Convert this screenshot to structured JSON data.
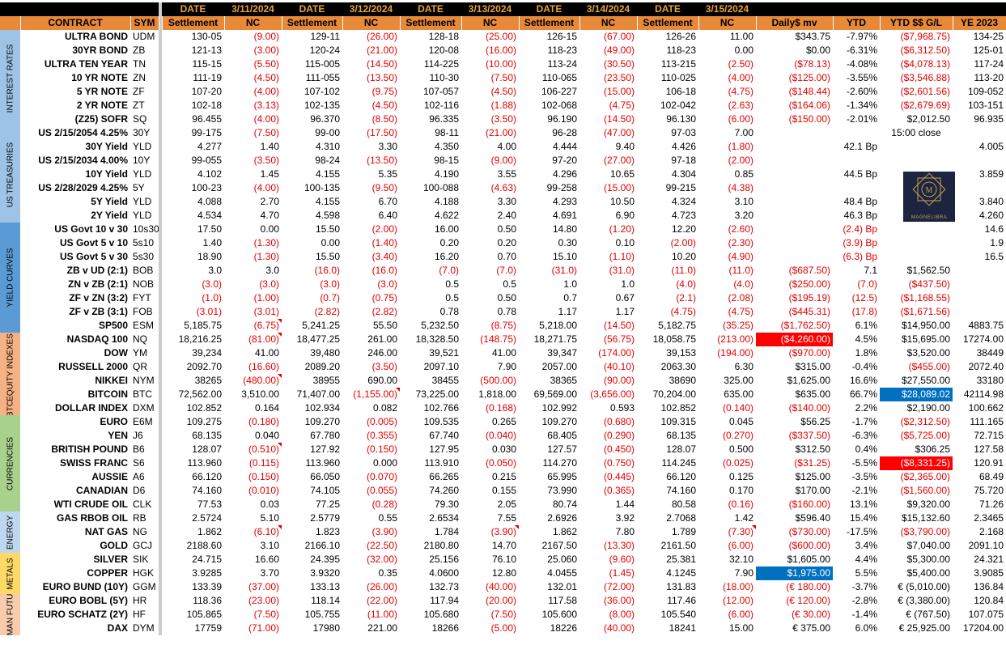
{
  "header_row1": [
    "",
    "",
    "",
    "DATE",
    "3/11/2024",
    "DATE",
    "3/12/2024",
    "DATE",
    "3/13/2024",
    "DATE",
    "3/14/2024",
    "DATE",
    "3/15/2024",
    "",
    "",
    "",
    ""
  ],
  "header_row2": [
    "",
    "CONTRACT",
    "SYM",
    "Settlement",
    "NC",
    "Settlement",
    "NC",
    "Settlement",
    "NC",
    "Settlement",
    "NC",
    "Settlement",
    "NC",
    "Daily$ mv",
    "YTD",
    "YTD $$ G/L",
    "YE 2023"
  ],
  "sections": [
    {
      "label": "INTEREST RATES",
      "color": "#9dc3e6",
      "rows": 7
    },
    {
      "label": "US TREASURIES",
      "color": "#9dc3e6",
      "rows": 7
    },
    {
      "label": "YIELD CURVES",
      "color": "#5b9bd5",
      "rows": 8
    },
    {
      "label": "EQUITY INDEXES",
      "color": "#f4b183",
      "rows": 5
    },
    {
      "label": "BTC",
      "color": "#f4b183",
      "rows": 1
    },
    {
      "label": "CURRENCIES",
      "color": "#a9d18e",
      "rows": 7
    },
    {
      "label": "ENERGY",
      "color": "#bdd7ee",
      "rows": 3
    },
    {
      "label": "METALS",
      "color": "#ffd966",
      "rows": 3
    },
    {
      "label": "GERMAN FUTURES",
      "color": "#f8cbad",
      "rows": 4
    }
  ],
  "rows": [
    [
      "ULTRA BOND",
      "UDM",
      "130-05",
      "(9.00)",
      "129-11",
      "(26.00)",
      "128-18",
      "(25.00)",
      "126-15",
      "(67.00)",
      "126-26",
      "11.00",
      "$343.75",
      "-7.97%",
      "($7,968.75)",
      "134-25"
    ],
    [
      "30YR BOND",
      "ZB",
      "121-13",
      "(3.00)",
      "120-24",
      "(21.00)",
      "120-08",
      "(16.00)",
      "118-23",
      "(49.00)",
      "118-23",
      "0.00",
      "$0.00",
      "-6.31%",
      "($6,312.50)",
      "125-01"
    ],
    [
      "ULTRA TEN YEAR",
      "TN",
      "115-15",
      "(5.50)",
      "115-005",
      "(14.50)",
      "114-225",
      "(10.00)",
      "113-24",
      "(30.50)",
      "113-215",
      "(2.50)",
      "($78.13)",
      "-4.08%",
      "($4,078.13)",
      "117-24"
    ],
    [
      "10 YR NOTE",
      "ZN",
      "111-19",
      "(4.50)",
      "111-055",
      "(13.50)",
      "110-30",
      "(7.50)",
      "110-065",
      "(23.50)",
      "110-025",
      "(4.00)",
      "($125.00)",
      "-3.55%",
      "($3,546.88)",
      "113-20"
    ],
    [
      "5 YR NOTE",
      "ZF",
      "107-20",
      "(4.00)",
      "107-102",
      "(9.75)",
      "107-057",
      "(4.50)",
      "106-227",
      "(15.00)",
      "106-18",
      "(4.75)",
      "($148.44)",
      "-2.60%",
      "($2,601.56)",
      "109-052"
    ],
    [
      "2 YR NOTE",
      "ZT",
      "102-18",
      "(3.13)",
      "102-135",
      "(4.50)",
      "102-116",
      "(1.88)",
      "102-068",
      "(4.75)",
      "102-042",
      "(2.63)",
      "($164.06)",
      "-1.34%",
      "($2,679.69)",
      "103-151"
    ],
    [
      "(Z25) SOFR",
      "SQ",
      "96.455",
      "(4.00)",
      "96.370",
      "(8.50)",
      "96.335",
      "(3.50)",
      "96.190",
      "(14.50)",
      "96.130",
      "(6.00)",
      "($150.00)",
      "-2.01%",
      "$2,012.50",
      "96.935"
    ],
    [
      "US 2/15/2054 4.25%",
      "30Y",
      "99-175",
      "(7.50)",
      "99-00",
      "(17.50)",
      "98-11",
      "(21.00)",
      "96-28",
      "(47.00)",
      "97-03",
      "7.00",
      "",
      "",
      "15:00 close",
      ""
    ],
    [
      "30Y Yield",
      "YLD",
      "4.277",
      "1.40",
      "4.310",
      "3.30",
      "4.350",
      "4.00",
      "4.444",
      "9.40",
      "4.426",
      "(1.80)",
      "",
      "42.1  Bp",
      "",
      "4.005"
    ],
    [
      "US 2/15/2034 4.00%",
      "10Y",
      "99-055",
      "(3.50)",
      "98-24",
      "(13.50)",
      "98-15",
      "(9.00)",
      "97-20",
      "(27.00)",
      "97-18",
      "(2.00)",
      "",
      "",
      "",
      ""
    ],
    [
      "10Y Yield",
      "YLD",
      "4.102",
      "1.45",
      "4.155",
      "5.35",
      "4.190",
      "3.55",
      "4.296",
      "10.65",
      "4.304",
      "0.85",
      "",
      "44.5  Bp",
      "",
      "3.859"
    ],
    [
      "US 2/28/2029 4.25%",
      "5Y",
      "100-23",
      "(4.00)",
      "100-135",
      "(9.50)",
      "100-088",
      "(4.63)",
      "99-258",
      "(15.00)",
      "99-215",
      "(4.38)",
      "",
      "",
      "",
      ""
    ],
    [
      "5Y Yield",
      "YLD",
      "4.088",
      "2.70",
      "4.155",
      "6.70",
      "4.188",
      "3.30",
      "4.293",
      "10.50",
      "4.324",
      "3.10",
      "",
      "48.4  Bp",
      "",
      "3.840"
    ],
    [
      "2Y Yield",
      "YLD",
      "4.534",
      "4.70",
      "4.598",
      "6.40",
      "4.622",
      "2.40",
      "4.691",
      "6.90",
      "4.723",
      "3.20",
      "",
      "46.3  Bp",
      "",
      "4.260"
    ],
    [
      "US Govt 10 v 30",
      "10s30",
      "17.50",
      "0.00",
      "15.50",
      "(2.00)",
      "16.00",
      "0.50",
      "14.80",
      "(1.20)",
      "12.20",
      "(2.60)",
      "",
      "(2.4)  Bp",
      "",
      "14.6"
    ],
    [
      "US Govt 5 v 10",
      "5s10",
      "1.40",
      "(1.30)",
      "0.00",
      "(1.40)",
      "0.20",
      "0.20",
      "0.30",
      "0.10",
      "(2.00)",
      "(2.30)",
      "",
      "(3.9)  Bp",
      "",
      "1.9"
    ],
    [
      "US Govt 5 v 30",
      "5s30",
      "18.90",
      "(1.30)",
      "15.50",
      "(3.40)",
      "16.20",
      "0.70",
      "15.10",
      "(1.10)",
      "10.20",
      "(4.90)",
      "",
      "(6.3)  Bp",
      "",
      "16.5"
    ],
    [
      "ZB v UD (2:1)",
      "BOB",
      "3.0",
      "3.0",
      "(16.0)",
      "(16.0)",
      "(7.0)",
      "(7.0)",
      "(31.0)",
      "(31.0)",
      "(11.0)",
      "(11.0)",
      "($687.50)",
      "7.1",
      "$1,562.50",
      ""
    ],
    [
      "ZN v ZB (2:1)",
      "NOB",
      "(3.0)",
      "(3.0)",
      "(3.0)",
      "(3.0)",
      "0.5",
      "0.5",
      "1.0",
      "1.0",
      "(4.0)",
      "(4.0)",
      "($250.00)",
      "(7.0)",
      "($437.50)",
      ""
    ],
    [
      "ZF v ZN (3:2)",
      "FYT",
      "(1.0)",
      "(1.00)",
      "(0.7)",
      "(0.75)",
      "0.5",
      "0.50",
      "0.7",
      "0.67",
      "(2.1)",
      "(2.08)",
      "($195.19)",
      "(12.5)",
      "($1,168.55)",
      ""
    ],
    [
      "ZF v ZB (3:1)",
      "FOB",
      "(3.01)",
      "(3.01)",
      "(2.82)",
      "(2.82)",
      "0.78",
      "0.78",
      "1.17",
      "1.17",
      "(4.75)",
      "(4.75)",
      "($445.31)",
      "(17.8)",
      "($1,671.56)",
      ""
    ],
    [
      "SP500",
      "ESM",
      "5,185.75",
      "(6.75)",
      "5,241.25",
      "55.50",
      "5,232.50",
      "(8.75)",
      "5,218.00",
      "(14.50)",
      "5,182.75",
      "(35.25)",
      "($1,762.50)",
      "6.1%",
      "$14,950.00",
      "4883.75"
    ],
    [
      "NASDAQ 100",
      "NQ",
      "18,216.25",
      "(81.00)",
      "18,477.25",
      "261.00",
      "18,328.50",
      "(148.75)",
      "18,271.75",
      "(56.75)",
      "18,058.75",
      "(213.00)",
      "($4,260.00)",
      "4.5%",
      "$15,695.00",
      "17274.00"
    ],
    [
      "DOW",
      "YM",
      "39,234",
      "41.00",
      "39,480",
      "246.00",
      "39,521",
      "41.00",
      "39,347",
      "(174.00)",
      "39,153",
      "(194.00)",
      "($970.00)",
      "1.8%",
      "$3,520.00",
      "38449"
    ],
    [
      "RUSSELL 2000",
      "QR",
      "2092.70",
      "(16.60)",
      "2089.20",
      "(3.50)",
      "2097.10",
      "7.90",
      "2057.00",
      "(40.10)",
      "2063.30",
      "6.30",
      "$315.00",
      "-0.4%",
      "($455.00)",
      "2072.40"
    ],
    [
      "NIKKEI",
      "NYM",
      "38265",
      "(480.00)",
      "38955",
      "690.00",
      "38455",
      "(500.00)",
      "38365",
      "(90.00)",
      "38690",
      "325.00",
      "$1,625.00",
      "16.6%",
      "$27,550.00",
      "33180"
    ],
    [
      "BITCOIN",
      "BTC",
      "72,562.00",
      "3,510.00",
      "71,407.00",
      "(1,155.00)",
      "73,225.00",
      "1,818.00",
      "69,569.00",
      "(3,656.00)",
      "70,204.00",
      "635.00",
      "$635.00",
      "66.7%",
      "$28,089.02",
      "42114.98"
    ],
    [
      "DOLLAR INDEX",
      "DXM",
      "102.852",
      "0.164",
      "102.934",
      "0.082",
      "102.766",
      "(0.168)",
      "102.992",
      "0.593",
      "102.852",
      "(0.140)",
      "($140.00)",
      "2.2%",
      "$2,190.00",
      "100.662"
    ],
    [
      "EURO",
      "E6M",
      "109.275",
      "(0.180)",
      "109.270",
      "(0.005)",
      "109.535",
      "0.265",
      "109.270",
      "(0.680)",
      "109.315",
      "0.045",
      "$56.25",
      "-1.7%",
      "($2,312.50)",
      "111.165"
    ],
    [
      "YEN",
      "J6",
      "68.135",
      "0.040",
      "67.780",
      "(0.355)",
      "67.740",
      "(0.040)",
      "68.405",
      "(0.290)",
      "68.135",
      "(0.270)",
      "($337.50)",
      "-6.3%",
      "($5,725.00)",
      "72.715"
    ],
    [
      "BRITISH POUND",
      "B6",
      "128.07",
      "(0.510)",
      "127.92",
      "(0.150)",
      "127.95",
      "0.030",
      "127.57",
      "(0.450)",
      "128.07",
      "0.500",
      "$312.50",
      "0.4%",
      "$306.25",
      "127.58"
    ],
    [
      "SWISS FRANC",
      "S6",
      "113.960",
      "(0.115)",
      "113.960",
      "0.000",
      "113.910",
      "(0.050)",
      "114.270",
      "(0.750)",
      "114.245",
      "(0.025)",
      "($31.25)",
      "-5.5%",
      "($8,331.25)",
      "120.91"
    ],
    [
      "AUSSIE",
      "A6",
      "66.120",
      "(0.150)",
      "66.050",
      "(0.070)",
      "66.265",
      "0.215",
      "65.995",
      "(0.445)",
      "66.120",
      "0.125",
      "$125.00",
      "-3.5%",
      "($2,365.00)",
      "68.49"
    ],
    [
      "CANADIAN",
      "D6",
      "74.160",
      "(0.010)",
      "74.105",
      "(0.055)",
      "74.260",
      "0.155",
      "73.990",
      "(0.365)",
      "74.160",
      "0.170",
      "$170.00",
      "-2.1%",
      "($1,560.00)",
      "75.720"
    ],
    [
      "WTI CRUDE OIL",
      "CLK",
      "77.53",
      "0.03",
      "77.25",
      "(0.28)",
      "79.30",
      "2.05",
      "80.74",
      "1.44",
      "80.58",
      "(0.16)",
      "($160.00)",
      "13.1%",
      "$9,320.00",
      "71.26"
    ],
    [
      "GAS RBOB OIL",
      "RB",
      "2.5724",
      "5.10",
      "2.5779",
      "0.55",
      "2.6534",
      "7.55",
      "2.6926",
      "3.92",
      "2.7068",
      "1.42",
      "$596.40",
      "15.4%",
      "$15,132.60",
      "2.3465"
    ],
    [
      "NAT GAS",
      "NG",
      "1.862",
      "(6.10)",
      "1.823",
      "(3.90)",
      "1.784",
      "(3.90)",
      "1.862",
      "7.80",
      "1.789",
      "(7.30)",
      "($730.00)",
      "-17.5%",
      "($3,790.00)",
      "2.168"
    ],
    [
      "GOLD",
      "GCJ",
      "2188.60",
      "3.10",
      "2166.10",
      "(22.50)",
      "2180.80",
      "14.70",
      "2167.50",
      "(13.30)",
      "2161.50",
      "(6.00)",
      "($600.00)",
      "3.4%",
      "$7,040.00",
      "2091.10"
    ],
    [
      "SILVER",
      "SIK",
      "24.715",
      "16.60",
      "24.395",
      "(32.00)",
      "25.156",
      "76.10",
      "25.060",
      "(9.60)",
      "25.381",
      "32.10",
      "$1,605.00",
      "4.4%",
      "$5,300.00",
      "24.321"
    ],
    [
      "COPPER",
      "HGK",
      "3.9285",
      "3.70",
      "3.9320",
      "0.35",
      "4.0600",
      "12.80",
      "4.0455",
      "(1.45)",
      "4.1245",
      "7.90",
      "$1,975.00",
      "5.5%",
      "$5,400.00",
      "3.9085"
    ],
    [
      "EURO BUND (10Y)",
      "GGM",
      "133.39",
      "(37.00)",
      "133.13",
      "(26.00)",
      "132.73",
      "(40.00)",
      "132.01",
      "(72.00)",
      "131.83",
      "(18.00)",
      "(€ 180.00)",
      "-3.7%",
      "€      (5,010.00)",
      "136.84"
    ],
    [
      "EURO BOBL (5Y)",
      "HR",
      "118.36",
      "(23.00)",
      "118.14",
      "(22.00)",
      "117.94",
      "(20.00)",
      "117.58",
      "(36.00)",
      "117.46",
      "(12.00)",
      "(€ 120.00)",
      "-2.8%",
      "€      (3,380.00)",
      "120.84"
    ],
    [
      "EURO SCHATZ (2Y)",
      "HF",
      "105.865",
      "(7.50)",
      "105.755",
      "(11.00)",
      "105.680",
      "(7.50)",
      "105.600",
      "(8.00)",
      "105.540",
      "(6.00)",
      "(€ 30.00)",
      "-1.4%",
      "€         (767.50)",
      "107.075"
    ],
    [
      "DAX",
      "DYM",
      "17759",
      "(71.00)",
      "17980",
      "221.00",
      "18266",
      "(5.00)",
      "18226",
      "(40.00)",
      "18241",
      "15.00",
      "€ 375.00",
      "6.0%",
      "€      25,925.00",
      "17204.00"
    ]
  ],
  "highlights": {
    "NQ_daily": "red",
    "BTC_ytdgl": "blue",
    "S6_ytdgl": "red",
    "HGK_daily": "blue"
  },
  "logo": {
    "text": "MAGNELIBRA",
    "monogram": "M"
  }
}
